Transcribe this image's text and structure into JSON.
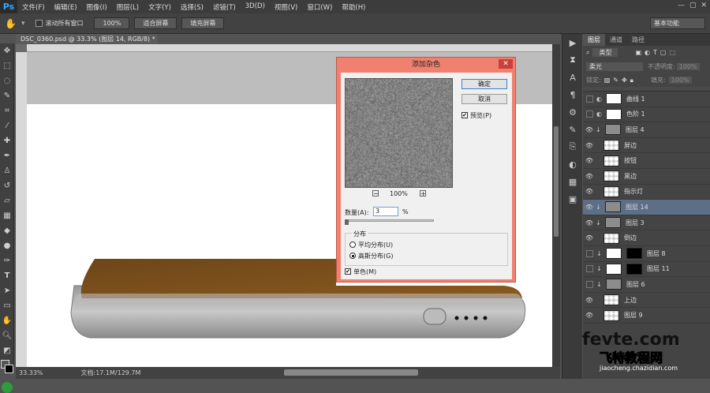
{
  "app": {
    "logo": "Ps"
  },
  "menubar": {
    "items": [
      "文件(F)",
      "编辑(E)",
      "图像(I)",
      "图层(L)",
      "文字(Y)",
      "选择(S)",
      "滤镜(T)",
      "3D(D)",
      "视图(V)",
      "窗口(W)",
      "帮助(H)"
    ],
    "window_controls": [
      "—",
      "▢",
      "✕"
    ]
  },
  "options": {
    "scroll_all_label": "滚动所有窗口",
    "zoom_100": "100%",
    "fit_screen": "适合屏幕",
    "fill_screen": "填充屏幕",
    "workspace": "基本功能"
  },
  "document": {
    "tab_title": "DSC_0360.psd @ 33.3% (图层 14, RGB/8) *",
    "zoom": "33.33%",
    "doc_info": "文档:17.1M/129.7M"
  },
  "layers_panel": {
    "tabs": [
      "图层",
      "通道",
      "路径"
    ],
    "filter": "类型",
    "blend_mode": "柔光",
    "opacity_label": "不透明度:",
    "opacity_value": "100%",
    "lock_label": "锁定:",
    "fill_label": "填充:",
    "fill_value": "100%",
    "layers": [
      {
        "name": "曲线 1",
        "visible": false,
        "thumb": "white",
        "adj": true
      },
      {
        "name": "色阶 1",
        "visible": false,
        "thumb": "white",
        "adj": true
      },
      {
        "name": "图层 4",
        "visible": true,
        "thumb": "gray",
        "clip": true
      },
      {
        "name": "屏边",
        "visible": true,
        "thumb": "chk"
      },
      {
        "name": "按钮",
        "visible": true,
        "thumb": "chk"
      },
      {
        "name": "黑边",
        "visible": true,
        "thumb": "chk"
      },
      {
        "name": "指示灯",
        "visible": true,
        "thumb": "chk"
      },
      {
        "name": "图层 14",
        "visible": true,
        "thumb": "gray",
        "clip": true,
        "selected": true
      },
      {
        "name": "图层 3",
        "visible": true,
        "thumb": "gray",
        "clip": true
      },
      {
        "name": "倒边",
        "visible": true,
        "thumb": "chk"
      },
      {
        "name": "图层 8",
        "visible": false,
        "thumb": "white",
        "mask": true,
        "clip": true
      },
      {
        "name": "图层 11",
        "visible": false,
        "thumb": "white",
        "mask": true,
        "clip": true
      },
      {
        "name": "图层 6",
        "visible": false,
        "thumb": "gray",
        "clip": true
      },
      {
        "name": "上边",
        "visible": true,
        "thumb": "chk"
      },
      {
        "name": "图层 9",
        "visible": true,
        "thumb": "chk"
      }
    ]
  },
  "dialog": {
    "title": "添加杂色",
    "ok": "确定",
    "cancel": "取消",
    "preview_label": "预览(P)",
    "zoom_minus": "−",
    "zoom_percent": "100%",
    "zoom_plus": "+",
    "amount_label": "数量(A):",
    "amount_value": "3",
    "amount_unit": "%",
    "distribution_label": "分布",
    "uniform": "平均分布(U)",
    "gaussian": "高斯分布(G)",
    "monochrome": "单色(M)"
  },
  "watermark": {
    "line1": "fevte.com",
    "line2": "飞特教程网",
    "line3": "jiaocheng.chazidian.com"
  }
}
